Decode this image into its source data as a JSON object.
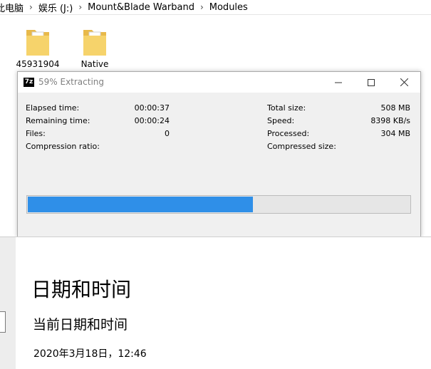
{
  "explorer": {
    "breadcrumb": [
      "此电脑",
      "娱乐 (J:)",
      "Mount&Blade Warband",
      "Modules"
    ],
    "folders": [
      {
        "label": "45931904"
      },
      {
        "label": "Native"
      }
    ]
  },
  "dialog": {
    "app_icon_text": "7z",
    "title": "59% Extracting",
    "progress_percent": 59,
    "left_stats": [
      {
        "label": "Elapsed time:",
        "value": "00:00:37"
      },
      {
        "label": "Remaining time:",
        "value": "00:00:24"
      },
      {
        "label": "Files:",
        "value": "0"
      },
      {
        "label": "Compression ratio:",
        "value": ""
      }
    ],
    "right_stats": [
      {
        "label": "Total size:",
        "value": "508 MB"
      },
      {
        "label": "Speed:",
        "value": "8398 KB/s"
      },
      {
        "label": "Processed:",
        "value": "304 MB"
      },
      {
        "label": "Compressed size:",
        "value": ""
      }
    ]
  },
  "settings": {
    "title": "日期和时间",
    "subtitle": "当前日期和时间",
    "datetime": "2020年3月18日，12:46"
  },
  "colors": {
    "progress": "#2f8fe8",
    "folder": "#f6d36b"
  }
}
